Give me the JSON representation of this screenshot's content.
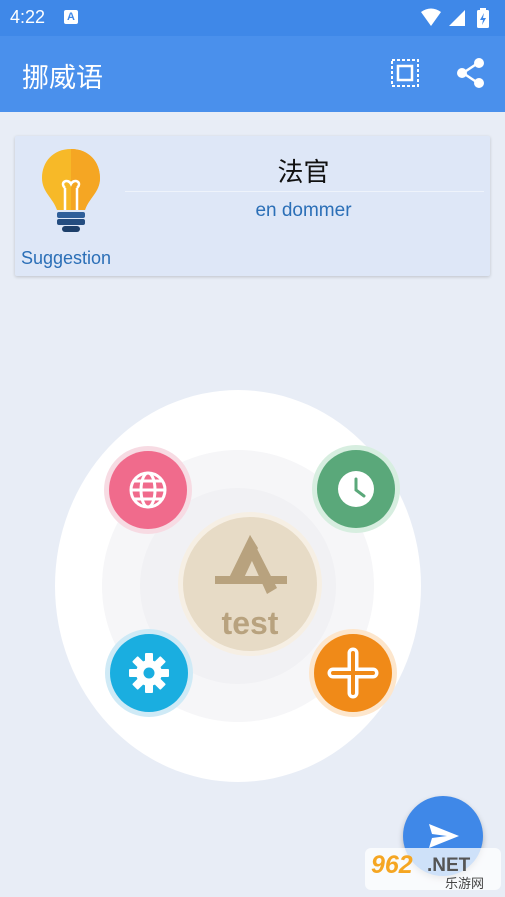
{
  "status_bar": {
    "time": "4:22",
    "notif_icon_letter": "A"
  },
  "app_bar": {
    "title": "挪威语",
    "fullscreen_icon": "fullscreen-icon",
    "share_icon": "share-icon"
  },
  "suggestion_card": {
    "label": "Suggestion",
    "word": "法官",
    "translation": "en dommer",
    "icon": "lightbulb-icon"
  },
  "wheel_menu": {
    "center_label": "test",
    "items": [
      {
        "icon": "globe-icon",
        "color": "#f06b8c"
      },
      {
        "icon": "clock-icon",
        "color": "#5aa87a"
      },
      {
        "icon": "gear-icon",
        "color": "#1aaee0"
      },
      {
        "icon": "plus-icon",
        "color": "#f08a18"
      }
    ]
  },
  "fab": {
    "icon": "send-icon"
  },
  "watermark": {
    "brand": "962",
    "suffix": ".NET",
    "caption": "乐游网"
  },
  "colors": {
    "primary": "#4a90ec",
    "status": "#3f88e8",
    "background": "#e8edf6",
    "card": "#dee7f7",
    "accent_text": "#2b6fb7"
  }
}
